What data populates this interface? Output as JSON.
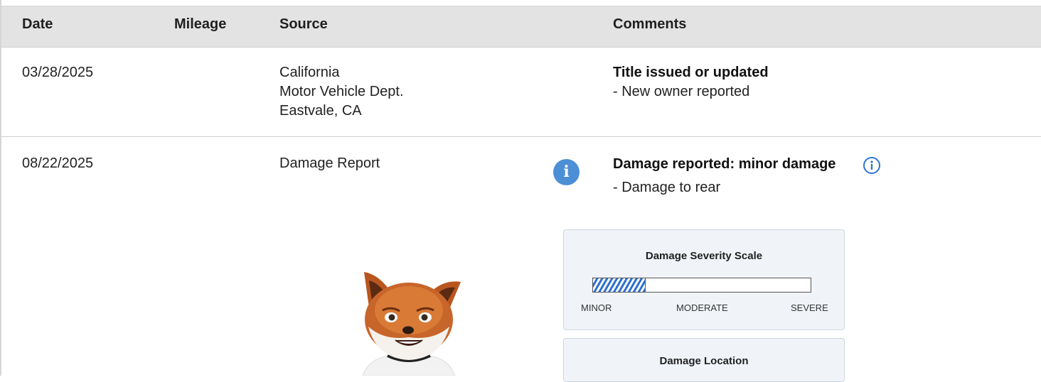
{
  "table": {
    "headers": [
      "Date",
      "Mileage",
      "Source",
      "Comments"
    ],
    "rows": [
      {
        "date": "03/28/2025",
        "mileage": "",
        "source": [
          "California",
          "Motor Vehicle Dept.",
          "Eastvale, CA"
        ],
        "comment_title": "Title issued or updated",
        "comment_detail": "- New owner reported"
      },
      {
        "date": "08/22/2025",
        "mileage": "",
        "source": [
          "Damage Report"
        ],
        "comment_title": "Damage reported: minor damage",
        "comment_detail": "- Damage to rear"
      }
    ]
  },
  "severity_panel": {
    "title": "Damage Severity Scale",
    "level_fraction": 0.24,
    "labels": [
      "MINOR",
      "MODERATE",
      "SEVERE"
    ],
    "fill_color": "#2e6fd0"
  },
  "location_panel": {
    "title": "Damage Location"
  },
  "icons": {
    "row2_info": "info-icon",
    "comment_info": "info-outline-icon",
    "mascot": "fox-mascot"
  },
  "colors": {
    "header_bg": "#e3e3e3",
    "info_blue": "#4d8fd6",
    "panel_bg": "#f0f4f9"
  }
}
